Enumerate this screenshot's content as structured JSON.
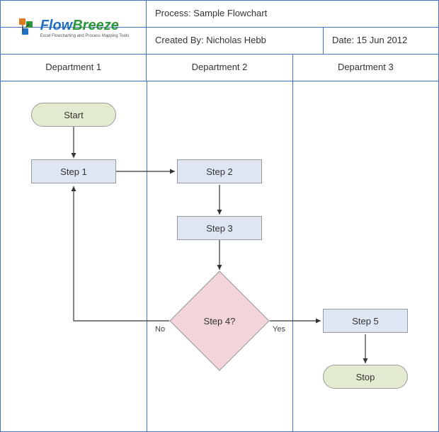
{
  "header": {
    "process_label": "Process: Sample Flowchart",
    "created_by_label": "Created By: Nicholas Hebb",
    "date_label": "Date: 15 Jun 2012"
  },
  "logo": {
    "title_flow": "Flow",
    "title_breeze": "Breeze",
    "subtitle": "Excel Flowcharting and Process Mapping Tools"
  },
  "departments": {
    "col1": "Department 1",
    "col2": "Department 2",
    "col3": "Department 3"
  },
  "nodes": {
    "start": "Start",
    "step1": "Step 1",
    "step2": "Step 2",
    "step3": "Step 3",
    "step4": "Step 4?",
    "step5": "Step 5",
    "stop": "Stop"
  },
  "edges": {
    "no_label": "No",
    "yes_label": "Yes"
  },
  "colors": {
    "border": "#4472c4",
    "terminator_fill": "#e2ebd0",
    "process_fill": "#dde6f2",
    "decision_fill": "#f3d4d8"
  }
}
